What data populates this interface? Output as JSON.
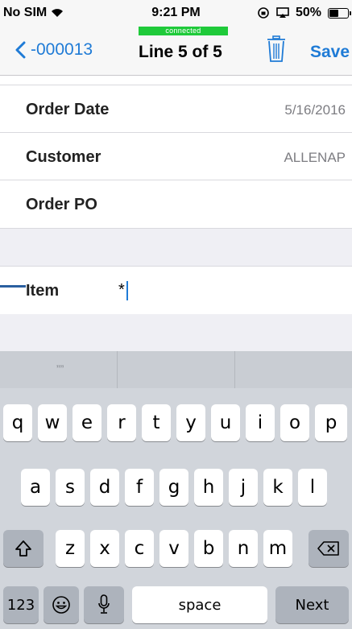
{
  "status_bar": {
    "carrier": "No SIM",
    "time": "9:21 PM",
    "battery": "50%",
    "battery_level": 0.5
  },
  "connection": {
    "status": "connected",
    "color": "#1fca3a"
  },
  "nav": {
    "back_label": "-000013",
    "title": "Line 5 of 5",
    "save_label": "Save",
    "accent_color": "#1f7bd6"
  },
  "form": {
    "order_date": {
      "label": "Order Date",
      "value": "5/16/2016"
    },
    "customer": {
      "label": "Customer",
      "value": "ALLENAP"
    },
    "order_po": {
      "label": "Order PO",
      "value": ""
    },
    "item": {
      "label": "Item",
      "value": "*"
    }
  },
  "keyboard": {
    "suggestions": [
      "””",
      "",
      ""
    ],
    "row1": [
      "q",
      "w",
      "e",
      "r",
      "t",
      "y",
      "u",
      "i",
      "o",
      "p"
    ],
    "row2": [
      "a",
      "s",
      "d",
      "f",
      "g",
      "h",
      "j",
      "k",
      "l"
    ],
    "row3": [
      "z",
      "x",
      "c",
      "v",
      "b",
      "n",
      "m"
    ],
    "numbers_key": "123",
    "space_key": "space",
    "next_key": "Next"
  }
}
